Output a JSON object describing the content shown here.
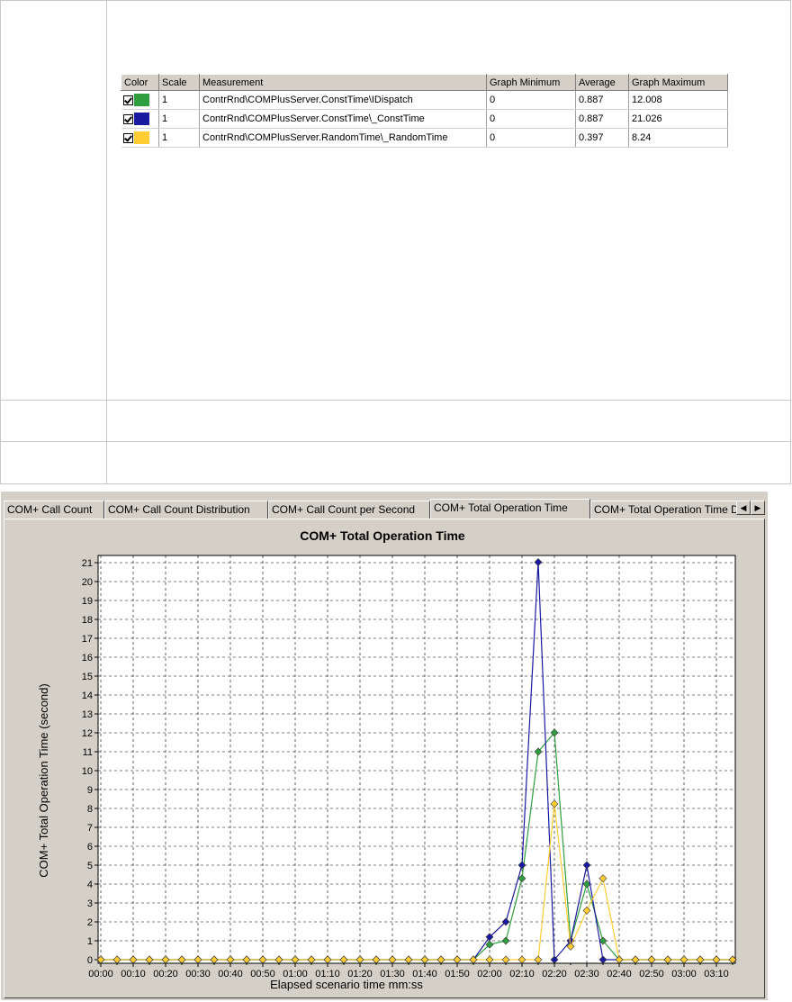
{
  "legend": {
    "headers": [
      "Color",
      "Scale",
      "Measurement",
      "Graph Minimum",
      "Average",
      "Graph Maximum"
    ],
    "rows": [
      {
        "color": "#2e9e3e",
        "scale": "1",
        "measurement": "ContrRnd\\COMPlusServer.ConstTime\\IDispatch",
        "min": "0",
        "avg": "0.887",
        "max": "12.008"
      },
      {
        "color": "#1a1aa0",
        "scale": "1",
        "measurement": "ContrRnd\\COMPlusServer.ConstTime\\_ConstTime",
        "min": "0",
        "avg": "0.887",
        "max": "21.026"
      },
      {
        "color": "#ffcc33",
        "scale": "1",
        "measurement": "ContrRnd\\COMPlusServer.RandomTime\\_RandomTime",
        "min": "0",
        "avg": "0.397",
        "max": "8.24"
      }
    ]
  },
  "tabs": [
    {
      "label": "COM+ Call Count",
      "active": false
    },
    {
      "label": "COM+ Call Count Distribution",
      "active": false
    },
    {
      "label": "COM+ Call Count per Second",
      "active": false
    },
    {
      "label": "COM+ Total Operation Time",
      "active": true
    },
    {
      "label": "COM+ Total Operation Time Distribution",
      "active": false
    }
  ],
  "chart_data": {
    "type": "line",
    "title": "COM+ Total Operation Time",
    "xlabel": "Elapsed scenario time mm:ss",
    "ylabel": "COM+ Total Operation Time (second)",
    "ylim": [
      0,
      21
    ],
    "xlim": [
      "00:00",
      "03:15"
    ],
    "grid": true,
    "x_tick_labels": [
      "00:00",
      "00:10",
      "00:20",
      "00:30",
      "00:40",
      "00:50",
      "01:00",
      "01:10",
      "01:20",
      "01:30",
      "01:40",
      "01:50",
      "02:00",
      "02:10",
      "02:20",
      "02:30",
      "02:40",
      "02:50",
      "03:00",
      "03:10"
    ],
    "y_tick_labels": [
      "0",
      "1",
      "2",
      "3",
      "4",
      "5",
      "6",
      "7",
      "8",
      "9",
      "10",
      "11",
      "12",
      "13",
      "14",
      "15",
      "16",
      "17",
      "18",
      "19",
      "20",
      "21"
    ],
    "x": [
      "00:00",
      "00:05",
      "00:10",
      "00:15",
      "00:20",
      "00:25",
      "00:30",
      "00:35",
      "00:40",
      "00:45",
      "00:50",
      "00:55",
      "01:00",
      "01:05",
      "01:10",
      "01:15",
      "01:20",
      "01:25",
      "01:30",
      "01:35",
      "01:40",
      "01:45",
      "01:50",
      "01:55",
      "02:00",
      "02:05",
      "02:10",
      "02:15",
      "02:20",
      "02:25",
      "02:30",
      "02:35",
      "02:40",
      "02:45",
      "02:50",
      "02:55",
      "03:00",
      "03:05",
      "03:10",
      "03:15"
    ],
    "series": [
      {
        "color": "#2e9e3e",
        "values": [
          0,
          0,
          0,
          0,
          0,
          0,
          0,
          0,
          0,
          0,
          0,
          0,
          0,
          0,
          0,
          0,
          0,
          0,
          0,
          0,
          0,
          0,
          0,
          0,
          0.8,
          1,
          4.3,
          11,
          12.008,
          1,
          4,
          1,
          0,
          0,
          0,
          0,
          0,
          0,
          0,
          0
        ]
      },
      {
        "color": "#1a1aa0",
        "values": [
          0,
          0,
          0,
          0,
          0,
          0,
          0,
          0,
          0,
          0,
          0,
          0,
          0,
          0,
          0,
          0,
          0,
          0,
          0,
          0,
          0,
          0,
          0,
          0,
          1.2,
          2,
          5,
          21.026,
          0,
          1,
          5,
          0,
          0,
          0,
          0,
          0,
          0,
          0,
          0,
          0
        ]
      },
      {
        "color": "#ffcc33",
        "values": [
          0,
          0,
          0,
          0,
          0,
          0,
          0,
          0,
          0,
          0,
          0,
          0,
          0,
          0,
          0,
          0,
          0,
          0,
          0,
          0,
          0,
          0,
          0,
          0,
          0,
          0,
          0,
          0,
          8.24,
          0.7,
          2.6,
          4.3,
          0,
          0,
          0,
          0,
          0,
          0,
          0,
          0
        ]
      }
    ]
  }
}
